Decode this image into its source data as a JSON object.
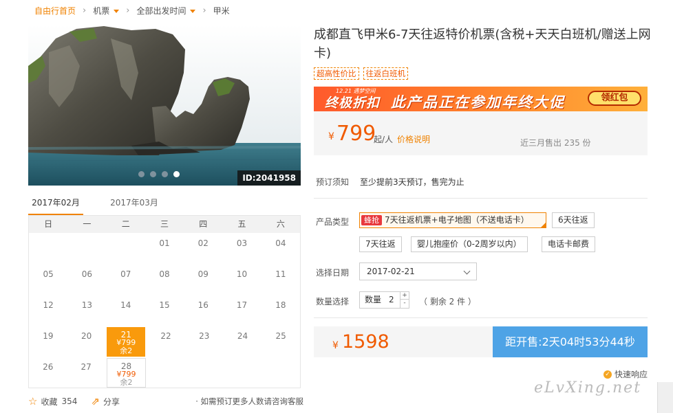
{
  "breadcrumb": {
    "home": "自由行首页",
    "item1": "机票",
    "item2": "全部出发时间",
    "item3": "甲米"
  },
  "hero": {
    "id_badge": "ID:2041958",
    "dots": 4,
    "active_dot": 4
  },
  "calendar": {
    "tabs": [
      "2017年02月",
      "2017年03月"
    ],
    "weekdays": [
      "日",
      "一",
      "二",
      "三",
      "四",
      "五",
      "六"
    ],
    "weeks": [
      [
        {
          "d": ""
        },
        {
          "d": ""
        },
        {
          "d": ""
        },
        {
          "d": "01"
        },
        {
          "d": "02"
        },
        {
          "d": "03"
        },
        {
          "d": "04"
        }
      ],
      [
        {
          "d": "05"
        },
        {
          "d": "06"
        },
        {
          "d": "07"
        },
        {
          "d": "08"
        },
        {
          "d": "09"
        },
        {
          "d": "10"
        },
        {
          "d": "11"
        }
      ],
      [
        {
          "d": "12"
        },
        {
          "d": "13"
        },
        {
          "d": "14"
        },
        {
          "d": "15"
        },
        {
          "d": "16"
        },
        {
          "d": "17"
        },
        {
          "d": "18"
        }
      ],
      [
        {
          "d": "19"
        },
        {
          "d": "20"
        },
        {
          "d": "21",
          "price": "¥799",
          "remain": "余2",
          "state": "sel"
        },
        {
          "d": "22"
        },
        {
          "d": "23"
        },
        {
          "d": "24"
        },
        {
          "d": "25"
        }
      ],
      [
        {
          "d": "26"
        },
        {
          "d": "27"
        },
        {
          "d": "28",
          "price": "¥799",
          "remain": "余2",
          "state": "avail"
        },
        {
          "d": ""
        },
        {
          "d": ""
        },
        {
          "d": ""
        },
        {
          "d": ""
        }
      ]
    ]
  },
  "left_footer": {
    "fav_label": "收藏",
    "fav_count": "354",
    "share_label": "分享",
    "note": "· 如需预订更多人数请咨询客服"
  },
  "product": {
    "title": "成都直飞甲米6-7天往返特价机票(含税+天天白班机/赠送上网卡)",
    "tags": [
      "超高性价比",
      "往返白班机"
    ],
    "banner": {
      "small": "12.21 遇梦空间",
      "big": "终极折扣",
      "mid": "此产品正在参加年终大促",
      "button": "领红包"
    },
    "price": {
      "currency": "¥",
      "value": "799",
      "unit": "起/人",
      "desc": "价格说明",
      "sold": "近三月售出 235 份"
    },
    "notice_label": "预订须知",
    "notice_text": "至少提前3天预订，售完为止",
    "type_label": "产品类型",
    "options": [
      {
        "badge": "蜂抢",
        "label": "7天往返机票+电子地图（不送电话卡）",
        "selected": true
      },
      {
        "label": "6天往返"
      },
      {
        "label": "7天往返"
      },
      {
        "label": "婴儿抱座价（0-2周岁以内）"
      },
      {
        "label": "电话卡邮费"
      }
    ],
    "date_label": "选择日期",
    "date_value": "2017-02-21",
    "qty_label": "数量选择",
    "qty_prefix": "数量",
    "qty_value": "2",
    "qty_plus": "+",
    "qty_minus": "-",
    "remain_text": "（ 剩余 2 件 ）",
    "total_currency": "¥",
    "total_value": "1598",
    "buy_button": "距开售:2天04时53分44秒",
    "fast_response": "快速响应"
  },
  "watermark": "eLvXing.net",
  "colors": {
    "accent": "#f08200",
    "price": "#f05a00",
    "button": "#4ea3e6"
  }
}
